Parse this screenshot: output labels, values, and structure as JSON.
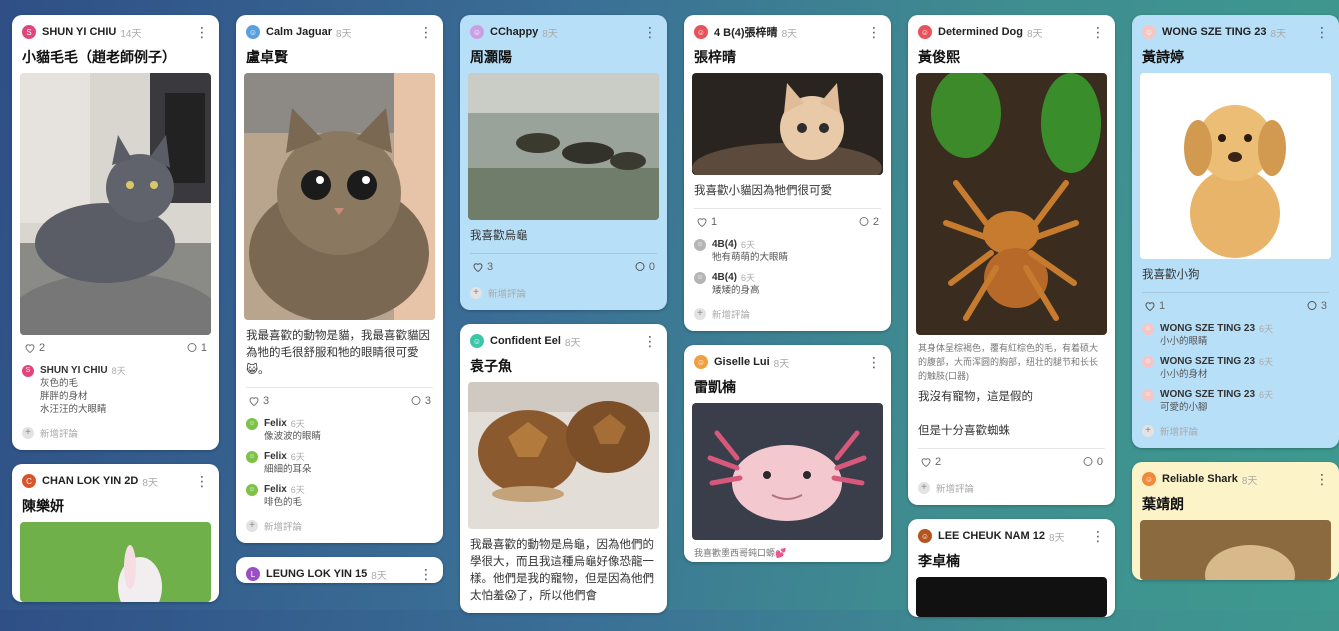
{
  "ui": {
    "add_comment": "新增評論"
  },
  "columns": [
    [
      {
        "id": "c1",
        "author": "SHUN YI CHIU",
        "time": "14天",
        "avatar_color": "#e0457b",
        "avatar_letter": "S",
        "title": "小貓毛毛（趙老師例子）",
        "likes": "2",
        "comments": "1",
        "comment_list": [
          {
            "author": "SHUN YI CHIU",
            "time": "8天",
            "avatar_color": "#e0457b",
            "avatar_letter": "S",
            "lines": [
              "灰色的毛",
              "胖胖的身材",
              "水汪汪的大眼睛"
            ]
          }
        ]
      },
      {
        "id": "c2",
        "author": "CHAN LOK YIN 2D",
        "time": "8天",
        "avatar_color": "#d9532b",
        "avatar_letter": "C",
        "title": "陳樂妍"
      }
    ],
    [
      {
        "id": "c3",
        "author": "Calm Jaguar",
        "time": "8天",
        "avatar_color": "#5aa0e0",
        "title": "盧卓賢",
        "text": "我最喜歡的動物是貓，我最喜歡貓因為牠的毛很舒服和牠的眼睛很可愛😺。",
        "likes": "3",
        "comments": "3",
        "comment_list": [
          {
            "author": "Felix",
            "time": "6天",
            "avatar_color": "#7cc246",
            "lines": [
              "像波波的眼睛"
            ]
          },
          {
            "author": "Felix",
            "time": "6天",
            "avatar_color": "#7cc246",
            "lines": [
              "細細的耳朵"
            ]
          },
          {
            "author": "Felix",
            "time": "6天",
            "avatar_color": "#7cc246",
            "lines": [
              "啡色的毛"
            ]
          }
        ]
      },
      {
        "id": "c4",
        "author": "LEUNG LOK YIN 15",
        "time": "8天",
        "avatar_color": "#9b4fc4",
        "avatar_letter": "L",
        "title": ""
      }
    ],
    [
      {
        "id": "c5",
        "author": "CChappy",
        "time": "8天",
        "avatar_color": "#c9a0e6",
        "blue": true,
        "title": "周灝陽",
        "text": "我喜歡烏龜",
        "likes": "3",
        "comments": "0"
      },
      {
        "id": "c6",
        "author": "Confident Eel",
        "time": "8天",
        "avatar_color": "#3cc6a8",
        "title": "袁子魚",
        "text": "我最喜歡的動物是烏龜，因為他們的學很大，而且我這種烏龜好像恐龍一樣。他們是我的寵物，但是因為他們太怕羞😱了，所以他們會"
      }
    ],
    [
      {
        "id": "c7",
        "author": "4 B(4)張梓晴",
        "time": "8天",
        "avatar_color": "#e8525a",
        "title": "張梓晴",
        "text": "我喜歡小貓因為牠們很可愛",
        "likes": "1",
        "comments": "2",
        "comment_list": [
          {
            "author": "4B(4)",
            "time": "6天",
            "avatar_color": "#b5b5b5",
            "lines": [
              "牠有萌萌的大眼睛"
            ]
          },
          {
            "author": "4B(4)",
            "time": "6天",
            "avatar_color": "#b5b5b5",
            "lines": [
              "矮矮的身高"
            ]
          }
        ]
      },
      {
        "id": "c8",
        "author": "Giselle Lui",
        "time": "8天",
        "avatar_color": "#f0a040",
        "title": "雷凱楠",
        "text": "我喜歡墨西哥鈍口螈💕"
      }
    ],
    [
      {
        "id": "c9",
        "author": "Determined Dog",
        "time": "8天",
        "avatar_color": "#e8525a",
        "title": "黃俊熙",
        "small_text": "其身体呈棕褐色，覆有紅棕色的毛，有着硕大的腹部，大而浑圆的胸部，纽壮的腿节和长长的触肢(口器)",
        "text_lines": [
          "我沒有寵物，這是假的",
          "",
          "但是十分喜歡蜘蛛"
        ],
        "likes": "2",
        "comments": "0"
      },
      {
        "id": "c10",
        "author": "LEE CHEUK NAM 12",
        "time": "8天",
        "avatar_color": "#b5541e",
        "title": "李卓楠"
      }
    ],
    [
      {
        "id": "c11",
        "author": "WONG SZE TING 23",
        "time": "8天",
        "avatar_color": "#f4c6c6",
        "blue": true,
        "title": "黃詩婷",
        "text": "我喜歡小狗",
        "likes": "1",
        "comments": "3",
        "comment_list": [
          {
            "author": "WONG SZE TING 23",
            "time": "6天",
            "avatar_color": "#f4c6c6",
            "lines": [
              "小小的眼睛"
            ]
          },
          {
            "author": "WONG SZE TING 23",
            "time": "6天",
            "avatar_color": "#f4c6c6",
            "lines": [
              "小小的身材"
            ]
          },
          {
            "author": "WONG SZE TING 23",
            "time": "6天",
            "avatar_color": "#f4c6c6",
            "lines": [
              "可愛的小腳"
            ]
          }
        ]
      },
      {
        "id": "c12",
        "author": "Reliable Shark",
        "time": "8天",
        "avatar_color": "#f08a3a",
        "yellow": true,
        "title": "葉靖朗"
      }
    ]
  ]
}
